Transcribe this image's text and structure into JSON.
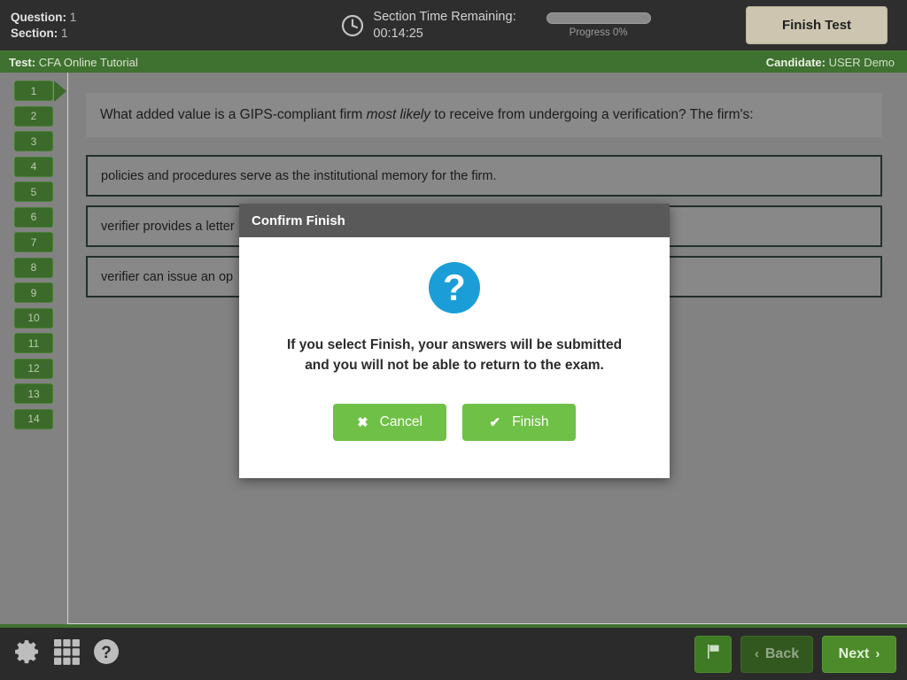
{
  "header": {
    "question_label": "Question:",
    "question_value": "1",
    "section_label": "Section:",
    "section_value": "1",
    "timer_label": "Section Time Remaining:",
    "timer_value": "00:14:25",
    "clock_icon": "clock-icon",
    "progress_label": "Progress 0%",
    "progress_percent": 0,
    "finish_test_label": "Finish Test"
  },
  "testbar": {
    "test_label": "Test:",
    "test_value": "CFA Online Tutorial",
    "candidate_label": "Candidate:",
    "candidate_value": "USER Demo",
    "color": "#3f7130"
  },
  "question_nav": {
    "items": [
      {
        "label": "1",
        "current": true
      },
      {
        "label": "2",
        "current": false
      },
      {
        "label": "3",
        "current": false
      },
      {
        "label": "4",
        "current": false
      },
      {
        "label": "5",
        "current": false
      },
      {
        "label": "6",
        "current": false
      },
      {
        "label": "7",
        "current": false
      },
      {
        "label": "8",
        "current": false
      },
      {
        "label": "9",
        "current": false
      },
      {
        "label": "10",
        "current": false
      },
      {
        "label": "11",
        "current": false
      },
      {
        "label": "12",
        "current": false
      },
      {
        "label": "13",
        "current": false
      },
      {
        "label": "14",
        "current": false
      }
    ]
  },
  "question": {
    "text_part1": "What added value is a GIPS-compliant firm ",
    "text_emphasis": "most likely",
    "text_part2": " to receive from undergoing a verification? The firm's:",
    "options": [
      {
        "text": "policies and procedures serve as the institutional memory for the firm."
      },
      {
        "text": "verifier provides a letter"
      },
      {
        "text": "verifier can issue an op"
      }
    ]
  },
  "footer": {
    "gear_icon": "gear-icon",
    "grid_icon": "grid-icon",
    "help_icon": "help-icon",
    "flag_icon": "flag-icon",
    "back_label": "Back",
    "back_chevron": "‹",
    "next_label": "Next",
    "next_chevron": "›"
  },
  "modal": {
    "title": "Confirm Finish",
    "icon": "question-mark-icon",
    "icon_glyph": "?",
    "icon_color": "#1b9ed8",
    "message_line1": "If you select Finish, your answers will be submitted",
    "message_line2": "and you will not be able to return to the exam.",
    "cancel_label": "Cancel",
    "cancel_icon": "✖",
    "finish_label": "Finish",
    "finish_icon": "✔",
    "button_color": "#6fc046"
  }
}
